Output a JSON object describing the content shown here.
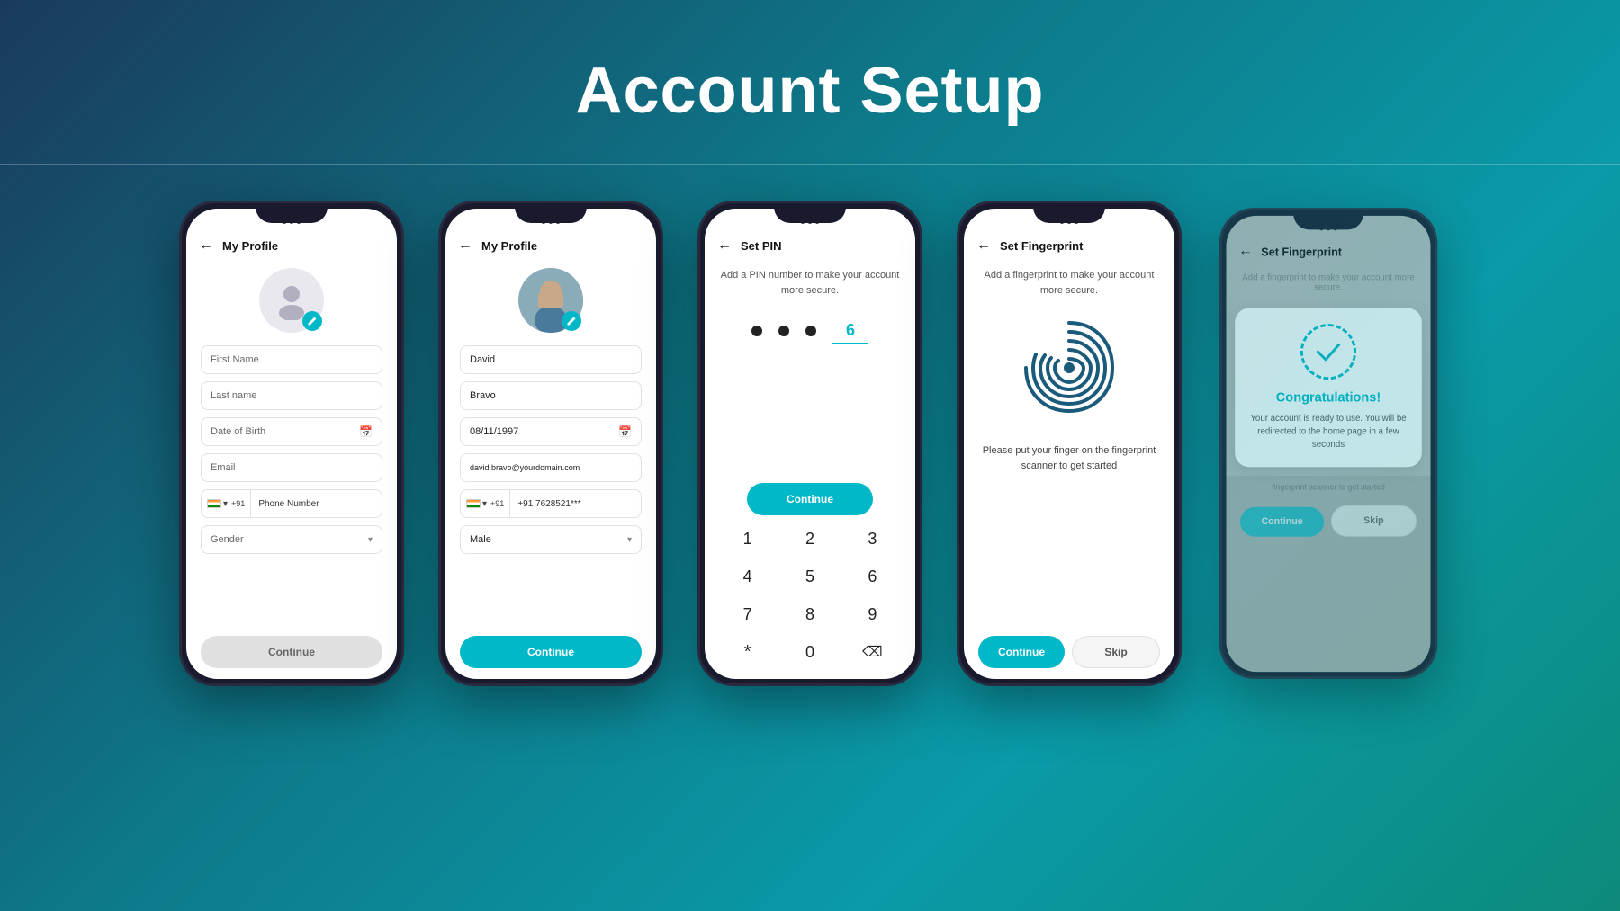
{
  "header": {
    "title": "Account Setup"
  },
  "phones": [
    {
      "id": "phone1",
      "title": "My Profile",
      "screen": "profile-empty",
      "fields": {
        "firstName": "First Name",
        "lastName": "Last name",
        "dob": "Date of Birth",
        "email": "Email",
        "phone": "Phone Number",
        "gender": "Gender"
      },
      "button": "Continue"
    },
    {
      "id": "phone2",
      "title": "My Profile",
      "screen": "profile-filled",
      "fields": {
        "firstName": "David",
        "lastName": "Bravo",
        "dob": "08/11/1997",
        "email": "david.bravo@yourdomain.com",
        "phone": "+91  7628521***",
        "gender": "Male"
      },
      "button": "Continue"
    },
    {
      "id": "phone3",
      "title": "Set PIN",
      "screen": "set-pin",
      "subtitle": "Add a PIN number to make your account more secure.",
      "pin": [
        "●",
        "●",
        "●",
        "6"
      ],
      "numpad": [
        "1",
        "2",
        "3",
        "4",
        "5",
        "6",
        "7",
        "8",
        "9",
        "*",
        "0",
        "⌫"
      ],
      "button": "Continue"
    },
    {
      "id": "phone4",
      "title": "Set Fingerprint",
      "screen": "set-fingerprint",
      "subtitle": "Add a fingerprint to make your account more secure.",
      "instruction": "Please put your finger on the fingerprint scanner to get started",
      "buttons": [
        "Continue",
        "Skip"
      ]
    },
    {
      "id": "phone5",
      "title": "Set Fingerprint",
      "screen": "congratulations",
      "subtitle": "Add a fingerprint to make your\naccount more secure.",
      "congrats_title": "Congratulations!",
      "congrats_text": "Your account is ready to use. You will be redirected to the home page in a few seconds",
      "buttons": [
        "Continue",
        "Skip"
      ]
    }
  ]
}
